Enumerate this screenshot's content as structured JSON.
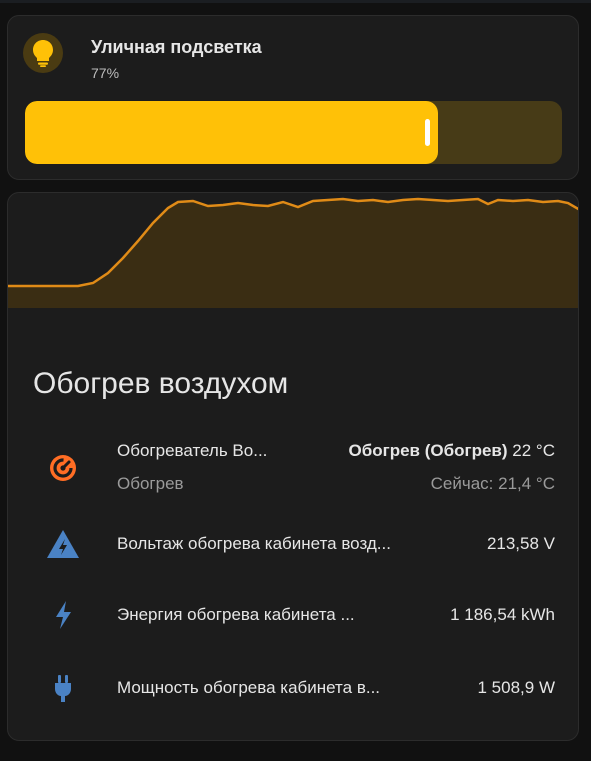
{
  "light": {
    "name": "Уличная подсветка",
    "state": "77%",
    "brightness_fraction": 0.77,
    "icon": "lightbulb-icon",
    "accent_color": "#ffc107",
    "track_color": "#473b17"
  },
  "thermostat": {
    "title": "Обогрев воздухом",
    "graph_color": "#e08b17",
    "entities": [
      {
        "name": "Обогреватель Во...",
        "mode": "Обогрев (Обогрев)",
        "target": "22 °C",
        "sub": "Обогрев",
        "current": "Сейчас: 21,4 °C",
        "icon": "thermostat-icon",
        "icon_color": "#ff6d24"
      },
      {
        "name": "Вольтаж обогрева кабинета возд...",
        "value": "213,58 V",
        "icon": "high-voltage-triangle-icon",
        "icon_color": "#4a82c4"
      },
      {
        "name": "Энергия обогрева кабинета ...",
        "value": "1 186,54 kWh",
        "icon": "lightning-bolt-icon",
        "icon_color": "#4a82c4"
      },
      {
        "name": "Мощность обогрева кабинета в...",
        "value": "1 508,9 W",
        "icon": "power-plug-icon",
        "icon_color": "#4a82c4"
      }
    ]
  }
}
